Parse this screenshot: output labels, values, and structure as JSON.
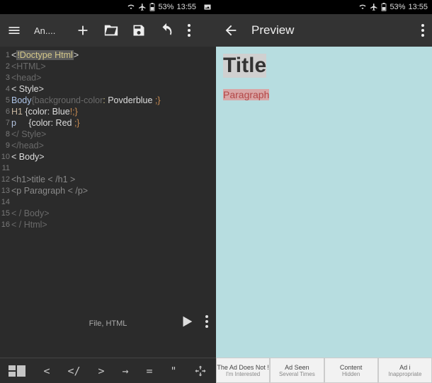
{
  "status": {
    "battery": "53%",
    "time": "13:55"
  },
  "left": {
    "appName": "An....",
    "fileLabel": "File, HTML",
    "code": {
      "l1_sel": "!Doctype Html",
      "l2": "<HTML>",
      "l3": "<head>",
      "l4_lt": "<",
      "l4_rest": " Style>",
      "l5_body": "Body",
      "l5_prop": "{background-color",
      "l5_sep": ": ",
      "l5_val": "Povderblue",
      "l5_end": " ;}",
      "l6_sel": "H1 ",
      "l6_prop": "{color: Blue",
      "l6_ex": "!",
      "l6_end": ";}",
      "l7_sel": "p     ",
      "l7_prop": "{color: Red ",
      "l7_end": ";}",
      "l8": "</ Style>",
      "l9": "</head>",
      "l10_lt": "<",
      "l10_rest": " Body>",
      "l11": "",
      "l12": "<h1>title < /h1 >",
      "l13": "<p Paragraph < /p>",
      "l14": "",
      "l15": "< / Body>",
      "l16": "< / Html>"
    },
    "bottom": {
      "lt": "<",
      "ct": "</",
      "gt": ">",
      "arr": "→",
      "eq": "=",
      "qt": "\""
    }
  },
  "right": {
    "title": "Preview",
    "rendered": {
      "h1": "Title",
      "p": "Paragraph"
    },
    "ads": {
      "a1l1": "The Ad Does Not !",
      "a1l2": "I'm Interested",
      "a2l1": "Ad Seen",
      "a2l2": "Several Times",
      "a3l1": "Content",
      "a3l2": "Hidden",
      "a4l1": "Ad i",
      "a4l2": "Inappropriate"
    }
  }
}
